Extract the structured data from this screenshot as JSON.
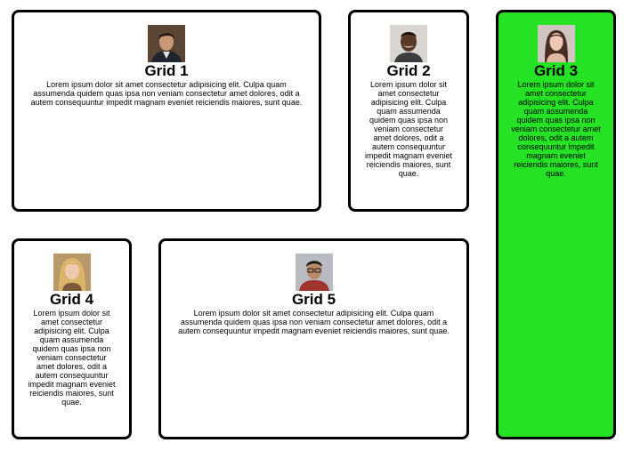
{
  "cards": [
    {
      "title": "Grid 1",
      "text": "Lorem ipsum dolor sit amet consectetur adipisicing elit. Culpa quam assumenda quidem quas ipsa non veniam consectetur amet dolores, odit a autem consequuntur impedit magnam eveniet reiciendis maiores, sunt quae.",
      "icon": "avatar-man-suit-icon"
    },
    {
      "title": "Grid 2",
      "text": "Lorem ipsum dolor sit amet consectetur adipisicing elit. Culpa quam assumenda quidem quas ipsa non veniam consectetur amet dolores, odit a autem consequuntur impedit magnam eveniet reiciendis maiores, sunt quae.",
      "icon": "avatar-man-smiling-icon"
    },
    {
      "title": "Grid 3",
      "text": "Lorem ipsum dolor sit amet consectetur adipisicing elit. Culpa quam assumenda quidem quas ipsa non veniam consectetur amet dolores, odit a autem consequuntur impedit magnam eveniet reiciendis maiores, sunt quae.",
      "icon": "avatar-woman-dark-hair-icon",
      "background": "#25e225"
    },
    {
      "title": "Grid 4",
      "text": "Lorem ipsum dolor sit amet consectetur adipisicing elit. Culpa quam assumenda quidem quas ipsa non veniam consectetur amet dolores, odit a autem consequuntur impedit magnam eveniet reiciendis maiores, sunt quae.",
      "icon": "avatar-woman-blonde-icon"
    },
    {
      "title": "Grid 5",
      "text": "Lorem ipsum dolor sit amet consectetur adipisicing elit. Culpa quam assumenda quidem quas ipsa non veniam consectetur amet dolores, odit a autem consequuntur impedit magnam eveniet reiciendis maiores, sunt quae.",
      "icon": "avatar-man-glasses-icon"
    }
  ],
  "colors": {
    "border": "#000000",
    "card_background": "#ffffff",
    "highlight": "#25e225"
  }
}
